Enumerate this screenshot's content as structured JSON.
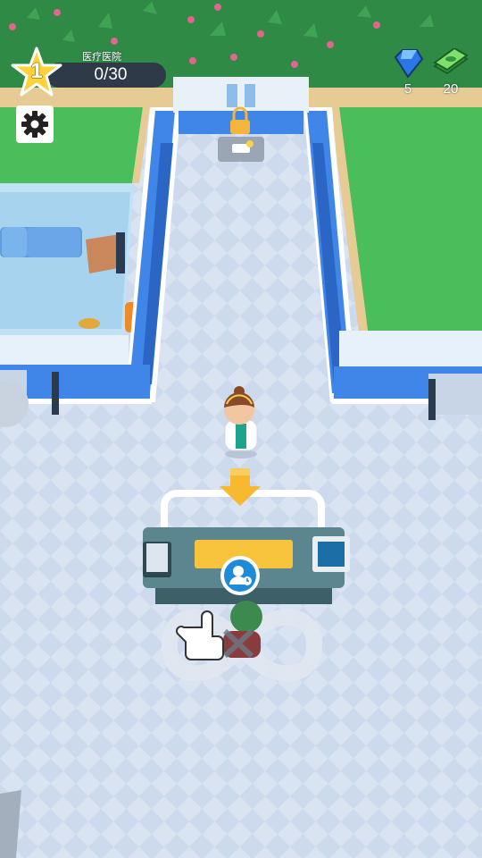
{
  "hud": {
    "level": "1",
    "hospital_name": "医疗医院",
    "progress": "0/30",
    "gems": "5",
    "cash": "20"
  },
  "icons": {
    "settings": "gear-icon",
    "gem": "blue-gem-icon",
    "cash": "cash-stack-icon",
    "lock": "padlock-icon",
    "avatar": "patient-avatar-icon",
    "hand": "pointing-hand-icon",
    "arrow": "down-arrow-icon"
  },
  "colors": {
    "grass": "#4bbf5b",
    "floor": "#d7e2f2",
    "wall_blue": "#3f86e8",
    "star": "#ffd23a",
    "desk": "#557d86",
    "arrow": "#f6b92f"
  }
}
